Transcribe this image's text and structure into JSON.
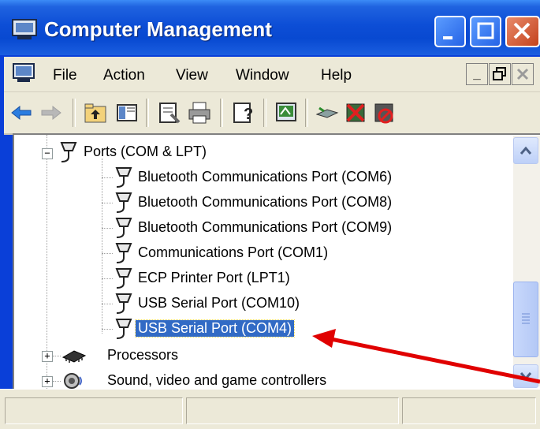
{
  "window": {
    "title": "Computer Management"
  },
  "menubar": {
    "items": [
      "File",
      "Action",
      "View",
      "Window",
      "Help"
    ]
  },
  "toolbar": {
    "buttons": [
      "back-icon",
      "forward-icon",
      "up-folder-icon",
      "show-hide-tree-icon",
      "properties-icon",
      "print-icon",
      "help-icon",
      "scan-hardware-icon",
      "update-driver-icon",
      "uninstall-icon",
      "disable-icon"
    ]
  },
  "tree": {
    "ports": {
      "label": "Ports (COM & LPT)",
      "expander": "−",
      "children": [
        "Bluetooth Communications Port (COM6)",
        "Bluetooth Communications Port (COM8)",
        "Bluetooth Communications Port (COM9)",
        "Communications Port (COM1)",
        "ECP Printer Port (LPT1)",
        "USB Serial Port (COM10)",
        "USB Serial Port (COM4)"
      ],
      "selected": "USB Serial Port (COM4)"
    },
    "processors": {
      "label": "Processors",
      "expander": "+"
    },
    "sound": {
      "label": "Sound, video and game controllers",
      "expander": "+"
    }
  },
  "colors": {
    "selection": "#316ac5",
    "annotation_arrow": "#e00000",
    "titlebar": "#0a4ed6"
  }
}
